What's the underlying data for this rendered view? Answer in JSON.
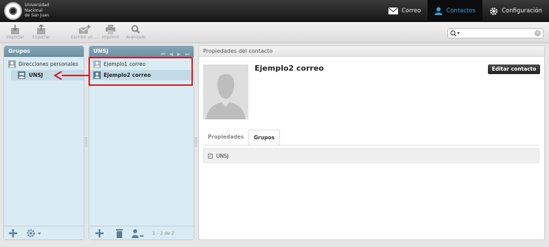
{
  "app": {
    "logo_lines": [
      "Universidad",
      "Nacional",
      "de San Juan"
    ]
  },
  "topnav": {
    "mail_label": "Correo",
    "contacts_label": "Contactos",
    "settings_label": "Configuración"
  },
  "toolbar": {
    "import_label": "Importar",
    "export_label": "Exportar",
    "write_label": "Escribir un ...",
    "print_label": "Imprimir",
    "advanced_label": "Avanzado"
  },
  "search": {
    "placeholder": ""
  },
  "groups": {
    "title": "Grupos",
    "items": [
      {
        "label": "Direcciones personales"
      },
      {
        "label": "UNSJ"
      }
    ]
  },
  "contacts": {
    "title": "UNSJ",
    "items": [
      {
        "label": "Ejemplo1 correo"
      },
      {
        "label": "Ejemplo2 correo"
      }
    ],
    "pagination": "1 – 2 de 2"
  },
  "props": {
    "title": "Propiedades del contacto",
    "contact_name": "Ejemplo2 correo",
    "edit_label": "Editar contacto",
    "tabs": [
      {
        "label": "Propiedades"
      },
      {
        "label": "Grupos"
      }
    ],
    "group_checkbox_label": "UNSJ"
  },
  "colors": {
    "accent": "#2ea3e2",
    "highlight": "#d8141a",
    "panel_bg": "#d9ecf4"
  }
}
